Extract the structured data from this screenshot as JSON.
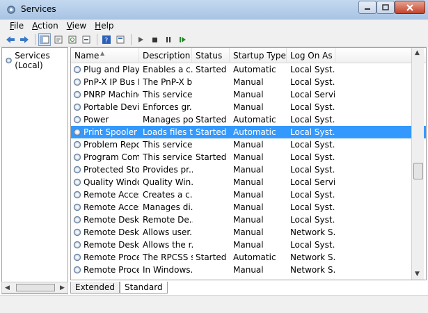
{
  "window": {
    "title": "Services",
    "icon": "services-gear-icon"
  },
  "menu": [
    {
      "label": "File",
      "key": "F",
      "rest": "ile"
    },
    {
      "label": "Action",
      "key": "A",
      "rest": "ction"
    },
    {
      "label": "View",
      "key": "V",
      "rest": "iew"
    },
    {
      "label": "Help",
      "key": "H",
      "rest": "elp"
    }
  ],
  "toolbar_icons": [
    "back-arrow-icon",
    "forward-arrow-icon",
    "show-hide-console-tree-icon",
    "properties-icon",
    "refresh-icon",
    "export-list-icon",
    "help-icon",
    "properties-sheet-icon",
    "start-service-icon",
    "stop-service-icon",
    "pause-service-icon",
    "restart-service-icon"
  ],
  "tree": {
    "root_label": "Services (Local)"
  },
  "columns": {
    "name": "Name",
    "description": "Description",
    "status": "Status",
    "startup": "Startup Type",
    "logon": "Log On As"
  },
  "services": [
    {
      "name": "Plug and Play",
      "description": "Enables a c...",
      "status": "Started",
      "startup": "Automatic",
      "logon": "Local Syst..."
    },
    {
      "name": "PnP-X IP Bus E...",
      "description": "The PnP-X b...",
      "status": "",
      "startup": "Manual",
      "logon": "Local Syst..."
    },
    {
      "name": "PNRP Machine...",
      "description": "This service ...",
      "status": "",
      "startup": "Manual",
      "logon": "Local Servi..."
    },
    {
      "name": "Portable Devic...",
      "description": "Enforces gr...",
      "status": "",
      "startup": "Manual",
      "logon": "Local Syst..."
    },
    {
      "name": "Power",
      "description": "Manages po...",
      "status": "Started",
      "startup": "Automatic",
      "logon": "Local Syst..."
    },
    {
      "name": "Print Spooler",
      "description": "Loads files t...",
      "status": "Started",
      "startup": "Automatic",
      "logon": "Local Syst...",
      "selected": true
    },
    {
      "name": "Problem Repo...",
      "description": "This service ...",
      "status": "",
      "startup": "Manual",
      "logon": "Local Syst..."
    },
    {
      "name": "Program Com...",
      "description": "This service ...",
      "status": "Started",
      "startup": "Manual",
      "logon": "Local Syst..."
    },
    {
      "name": "Protected Stor...",
      "description": "Provides pr...",
      "status": "",
      "startup": "Manual",
      "logon": "Local Syst..."
    },
    {
      "name": "Quality Windo...",
      "description": "Quality Win...",
      "status": "",
      "startup": "Manual",
      "logon": "Local Servi..."
    },
    {
      "name": "Remote Acces...",
      "description": "Creates a c...",
      "status": "",
      "startup": "Manual",
      "logon": "Local Syst..."
    },
    {
      "name": "Remote Acces...",
      "description": "Manages di...",
      "status": "",
      "startup": "Manual",
      "logon": "Local Syst..."
    },
    {
      "name": "Remote Deskt...",
      "description": "Remote De...",
      "status": "",
      "startup": "Manual",
      "logon": "Local Syst..."
    },
    {
      "name": "Remote Deskt...",
      "description": "Allows user...",
      "status": "",
      "startup": "Manual",
      "logon": "Network S..."
    },
    {
      "name": "Remote Deskt...",
      "description": "Allows the r...",
      "status": "",
      "startup": "Manual",
      "logon": "Local Syst..."
    },
    {
      "name": "Remote Proce...",
      "description": "The RPCSS s...",
      "status": "Started",
      "startup": "Automatic",
      "logon": "Network S..."
    },
    {
      "name": "Remote Proce...",
      "description": "In Windows...",
      "status": "",
      "startup": "Manual",
      "logon": "Network S..."
    }
  ],
  "tabs": [
    {
      "label": "Extended",
      "active": false
    },
    {
      "label": "Standard",
      "active": true
    }
  ],
  "colors": {
    "selection": "#3399ff",
    "titlebar": "#b9d1ea"
  }
}
